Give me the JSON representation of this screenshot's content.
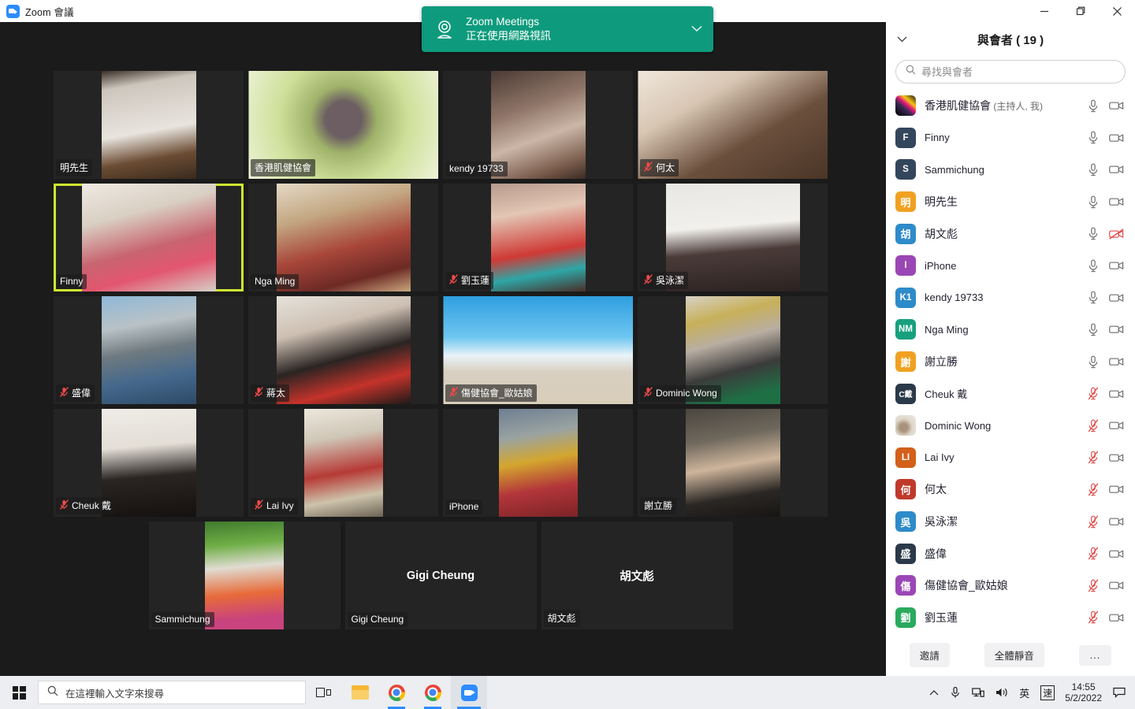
{
  "window": {
    "title": "Zoom 會議",
    "logo_icon": "zoom-logo-icon",
    "minimize_icon": "minimize-icon",
    "maximize_icon": "maximize-icon",
    "close_icon": "close-icon"
  },
  "banner": {
    "icon": "webcam-icon",
    "line1": "Zoom Meetings",
    "line2": "正在使用網路視訊",
    "chevron_icon": "chevron-down-icon",
    "color": "#0e9b7d"
  },
  "grid": {
    "active_border_color": "#cfe830",
    "rows": [
      [
        {
          "name": "明先生",
          "muted": false,
          "feed": "f-mingsir",
          "feedw": "w120",
          "active": false,
          "video": true
        },
        {
          "name": "香港肌健協會",
          "muted": false,
          "feed": "f-hkmda",
          "feedw": "wide",
          "active": false,
          "video": true
        },
        {
          "name": "kendy 19733",
          "muted": false,
          "feed": "f-kendy",
          "feedw": "w120",
          "active": false,
          "video": true
        },
        {
          "name": "何太",
          "muted": true,
          "feed": "f-hotai",
          "feedw": "wide",
          "active": false,
          "video": true
        }
      ],
      [
        {
          "name": "Finny",
          "muted": false,
          "feed": "f-finny",
          "feedw": "w170",
          "active": true,
          "video": true
        },
        {
          "name": "Nga Ming",
          "muted": false,
          "feed": "f-ngaming",
          "feedw": "w170",
          "active": false,
          "video": true
        },
        {
          "name": "劉玉蓮",
          "muted": true,
          "feed": "f-lauyuklin",
          "feedw": "w120",
          "active": false,
          "video": true
        },
        {
          "name": "吳泳潔",
          "muted": true,
          "feed": "f-ngwingkit",
          "feedw": "w170",
          "active": false,
          "video": true
        }
      ],
      [
        {
          "name": "盛偉",
          "muted": true,
          "feed": "f-shingwai",
          "feedw": "w120",
          "active": false,
          "video": true
        },
        {
          "name": "蔣太",
          "muted": true,
          "feed": "f-cheungtai",
          "feedw": "w170",
          "active": false,
          "video": true
        },
        {
          "name": "傷健協會_歐姑娘",
          "muted": true,
          "feed": "f-aulady",
          "feedw": "wide",
          "active": false,
          "video": true
        },
        {
          "name": "Dominic Wong",
          "muted": true,
          "feed": "f-dominic",
          "feedw": "w120",
          "active": false,
          "video": true
        }
      ],
      [
        {
          "name": "Cheuk 戴",
          "muted": true,
          "feed": "f-cheuk",
          "feedw": "w120",
          "active": false,
          "video": true
        },
        {
          "name": "Lai Ivy",
          "muted": true,
          "feed": "f-laiivy",
          "feedw": "w100",
          "active": false,
          "video": true
        },
        {
          "name": "iPhone",
          "muted": false,
          "feed": "f-iphone",
          "feedw": "w100",
          "active": false,
          "video": true
        },
        {
          "name": "謝立勝",
          "muted": false,
          "feed": "f-tselapsing",
          "feedw": "w120",
          "active": false,
          "video": true
        }
      ],
      [
        {
          "name": "Sammichung",
          "muted": false,
          "feed": "f-sammi",
          "feedw": "w100",
          "active": false,
          "video": true
        },
        {
          "name": "Gigi Cheung",
          "center_label": "Gigi Cheung",
          "muted": false,
          "feed": "",
          "feedw": "",
          "active": false,
          "video": false
        },
        {
          "name": "胡文彪",
          "center_label": "胡文彪",
          "muted": false,
          "feed": "",
          "feedw": "",
          "active": false,
          "video": false
        }
      ]
    ]
  },
  "panel": {
    "collapse_icon": "chevron-down-icon",
    "title": "與會者 ( 19 )",
    "search": {
      "icon": "search-icon",
      "placeholder": "尋找與會者",
      "value": ""
    },
    "participants": [
      {
        "initials": "",
        "avatar_class": "host",
        "avatar_color": "#1b1b1b",
        "name": "香港肌健協會",
        "suffix": " (主持人, 我)",
        "cjk": true,
        "mic": "mic-on",
        "cam": "cam-on"
      },
      {
        "initials": "F",
        "avatar_class": "",
        "avatar_color": "#33465c",
        "name": "Finny",
        "suffix": "",
        "cjk": false,
        "mic": "mic-on",
        "cam": "cam-on"
      },
      {
        "initials": "S",
        "avatar_class": "",
        "avatar_color": "#33465c",
        "name": "Sammichung",
        "suffix": "",
        "cjk": false,
        "mic": "mic-on",
        "cam": "cam-on"
      },
      {
        "initials": "明",
        "avatar_class": "cjk",
        "avatar_color": "#f0a122",
        "name": "明先生",
        "suffix": "",
        "cjk": true,
        "mic": "mic-on",
        "cam": "cam-on"
      },
      {
        "initials": "胡",
        "avatar_class": "cjk",
        "avatar_color": "#2e8bc9",
        "name": "胡文彪",
        "suffix": "",
        "cjk": true,
        "mic": "mic-on",
        "cam": "cam-off"
      },
      {
        "initials": "I",
        "avatar_class": "",
        "avatar_color": "#9b46b5",
        "name": "iPhone",
        "suffix": "",
        "cjk": false,
        "mic": "mic-on",
        "cam": "cam-on"
      },
      {
        "initials": "K1",
        "avatar_class": "",
        "avatar_color": "#2e8bc9",
        "name": "kendy 19733",
        "suffix": "",
        "cjk": false,
        "mic": "mic-on",
        "cam": "cam-on"
      },
      {
        "initials": "NM",
        "avatar_class": "",
        "avatar_color": "#17a07e",
        "name": "Nga Ming",
        "suffix": "",
        "cjk": false,
        "mic": "mic-on",
        "cam": "cam-on"
      },
      {
        "initials": "謝",
        "avatar_class": "cjk",
        "avatar_color": "#f0a122",
        "name": "謝立勝",
        "suffix": "",
        "cjk": true,
        "mic": "mic-on",
        "cam": "cam-on"
      },
      {
        "initials": "C戴",
        "avatar_class": "cheuk",
        "avatar_color": "#2b3a4a",
        "name": "Cheuk 戴",
        "suffix": "",
        "cjk": false,
        "mic": "mic-off",
        "cam": "cam-on"
      },
      {
        "initials": "",
        "avatar_class": "dog",
        "avatar_color": "#d9d4cd",
        "name": "Dominic Wong",
        "suffix": "",
        "cjk": false,
        "mic": "mic-off",
        "cam": "cam-on"
      },
      {
        "initials": "LI",
        "avatar_class": "",
        "avatar_color": "#d2601a",
        "name": "Lai Ivy",
        "suffix": "",
        "cjk": false,
        "mic": "mic-off",
        "cam": "cam-on"
      },
      {
        "initials": "何",
        "avatar_class": "cjk",
        "avatar_color": "#c0392b",
        "name": "何太",
        "suffix": "",
        "cjk": true,
        "mic": "mic-off",
        "cam": "cam-on"
      },
      {
        "initials": "吳",
        "avatar_class": "cjk",
        "avatar_color": "#2e8bc9",
        "name": "吳泳潔",
        "suffix": "",
        "cjk": true,
        "mic": "mic-off",
        "cam": "cam-on"
      },
      {
        "initials": "盛",
        "avatar_class": "cjk",
        "avatar_color": "#2b3a4a",
        "name": "盛偉",
        "suffix": "",
        "cjk": true,
        "mic": "mic-off",
        "cam": "cam-on"
      },
      {
        "initials": "傷",
        "avatar_class": "cjk",
        "avatar_color": "#9b46b5",
        "name": "傷健協會_歐姑娘",
        "suffix": "",
        "cjk": true,
        "mic": "mic-off",
        "cam": "cam-on"
      },
      {
        "initials": "劉",
        "avatar_class": "cjk",
        "avatar_color": "#2aaa5e",
        "name": "劉玉蓮",
        "suffix": "",
        "cjk": true,
        "mic": "mic-off",
        "cam": "cam-on"
      }
    ],
    "footer": {
      "invite": "邀請",
      "mute_all": "全體靜音",
      "more": "..."
    }
  },
  "taskbar": {
    "start_icon": "windows-start-icon",
    "search": {
      "icon": "search-icon",
      "placeholder": "在這裡輸入文字來搜尋"
    },
    "items": [
      {
        "name": "task-view-icon"
      },
      {
        "name": "file-explorer-icon"
      },
      {
        "name": "chrome-icon"
      },
      {
        "name": "chrome-icon"
      },
      {
        "name": "zoom-icon"
      }
    ],
    "tray": [
      {
        "name": "show-hidden-icons-chevron",
        "glyph": "^"
      },
      {
        "name": "microphone-icon",
        "glyph": ""
      },
      {
        "name": "network-icon",
        "glyph": ""
      },
      {
        "name": "volume-icon",
        "glyph": ""
      },
      {
        "name": "ime-language-indicator",
        "glyph": "英"
      },
      {
        "name": "ime-speed-indicator",
        "glyph": "速"
      }
    ],
    "clock": {
      "time": "14:55",
      "date": "5/2/2022"
    },
    "action_center_icon": "action-center-icon"
  }
}
